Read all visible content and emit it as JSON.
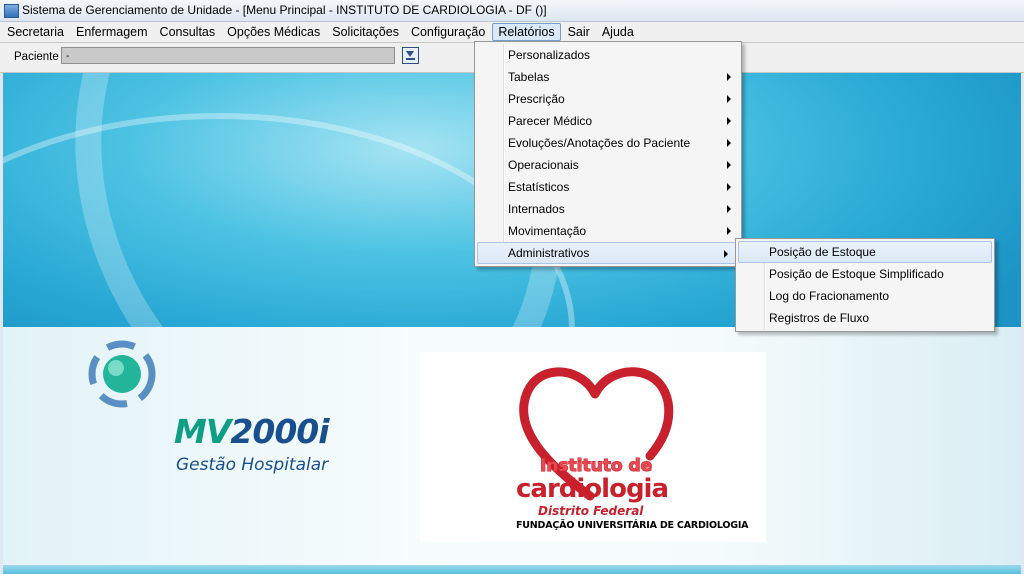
{
  "window": {
    "title": "Sistema de Gerenciamento de Unidade - [Menu Principal - INSTITUTO DE CARDIOLOGIA - DF ()]"
  },
  "menubar": {
    "items": [
      {
        "label": "Secretaria"
      },
      {
        "label": "Enfermagem"
      },
      {
        "label": "Consultas"
      },
      {
        "label": "Opções Médicas"
      },
      {
        "label": "Solicitações"
      },
      {
        "label": "Configuração"
      },
      {
        "label": "Relatórios",
        "active": true
      },
      {
        "label": "Sair"
      },
      {
        "label": "Ajuda"
      }
    ]
  },
  "toolbar": {
    "patient_label": "Paciente",
    "patient_value": "-"
  },
  "relatorios_menu": {
    "items": [
      {
        "label": "Personalizados",
        "submenu": false
      },
      {
        "label": "Tabelas",
        "submenu": true
      },
      {
        "label": "Prescrição",
        "submenu": true
      },
      {
        "label": "Parecer Médico",
        "submenu": true
      },
      {
        "label": "Evoluções/Anotações do Paciente",
        "submenu": true
      },
      {
        "label": "Operacionais",
        "submenu": true
      },
      {
        "label": "Estatísticos",
        "submenu": true
      },
      {
        "label": "Internados",
        "submenu": true
      },
      {
        "label": "Movimentação",
        "submenu": true
      },
      {
        "label": "Administrativos",
        "submenu": true,
        "highlighted": true
      }
    ]
  },
  "administrativos_submenu": {
    "items": [
      {
        "label": "Posição de Estoque",
        "highlighted": true
      },
      {
        "label": "Posição de Estoque Simplificado"
      },
      {
        "label": "Log do Fracionamento"
      },
      {
        "label": "Registros de Fluxo"
      }
    ]
  },
  "branding": {
    "mv_name": "MV",
    "mv_version": "2000i",
    "mv_tagline": "Gestão Hospitalar",
    "cardio_line1": "Instituto de",
    "cardio_line2": "cardiologia",
    "cardio_line3": "Distrito Federal",
    "cardio_line4": "FUNDAÇÃO UNIVERSITÁRIA DE CARDIOLOGIA",
    "colors": {
      "mv_green": "#0e9e84",
      "mv_blue": "#1a4f8f",
      "cardio_red": "#c8202c"
    }
  }
}
